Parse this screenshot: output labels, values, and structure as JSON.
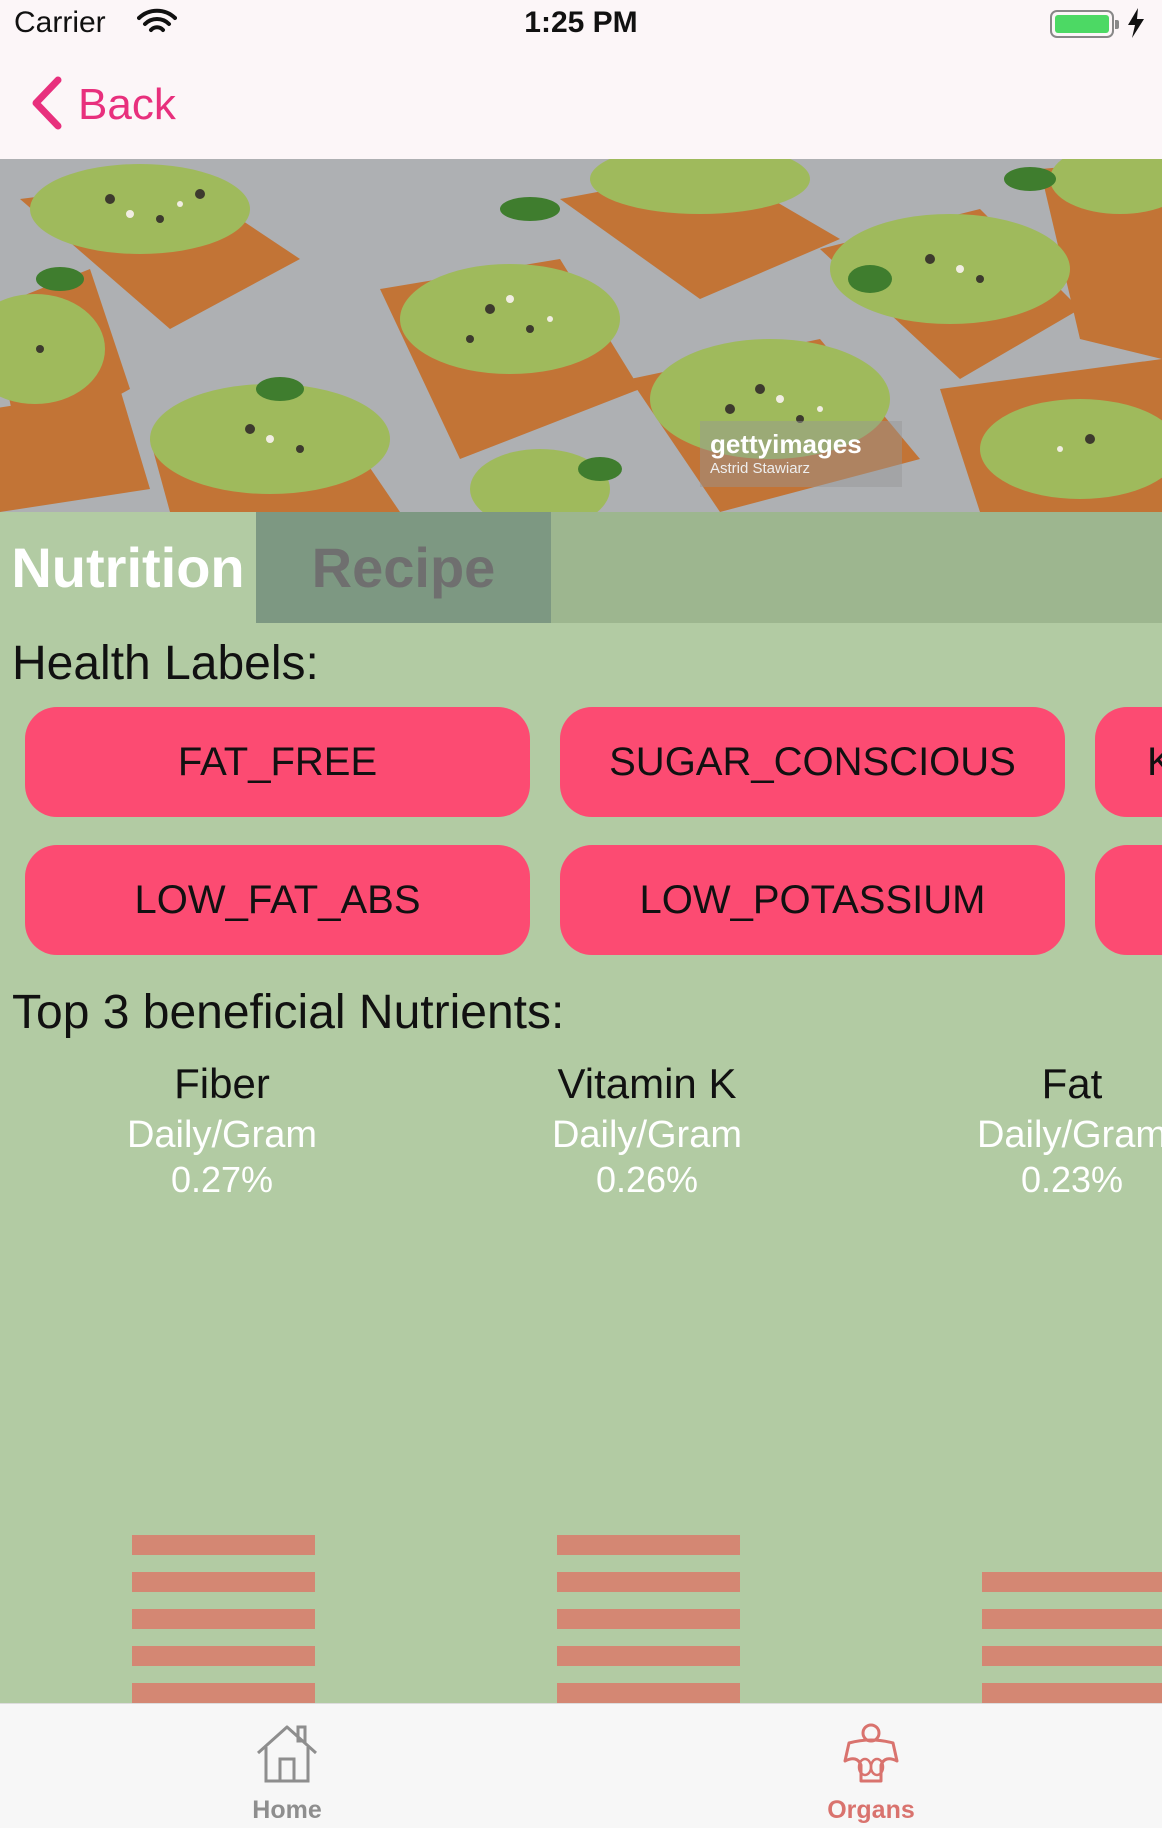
{
  "status_bar": {
    "carrier": "Carrier",
    "time": "1:25 PM"
  },
  "nav": {
    "back_label": "Back"
  },
  "hero": {
    "watermark_brand": "gettyimages",
    "watermark_credit": "Astrid Stawiarz"
  },
  "tabs": [
    {
      "label": "Nutrition",
      "selected": true
    },
    {
      "label": "Recipe",
      "selected": false
    }
  ],
  "health_labels": {
    "title": "Health Labels:",
    "row1": [
      "FAT_FREE",
      "SUGAR_CONSCIOUS",
      "K"
    ],
    "row2": [
      "LOW_FAT_ABS",
      "LOW_POTASSIUM",
      ""
    ]
  },
  "nutrients": {
    "title": "Top 3 beneficial Nutrients:",
    "items": [
      {
        "name": "Fiber",
        "unit": "Daily/Gram",
        "value": "0.27%"
      },
      {
        "name": "Vitamin K",
        "unit": "Daily/Gram",
        "value": "0.26%"
      },
      {
        "name": "Fat",
        "unit": "Daily/Gram",
        "value": "0.23%"
      }
    ]
  },
  "tab_bar": {
    "items": [
      {
        "label": "Home",
        "icon": "house-icon"
      },
      {
        "label": "Organs",
        "icon": "organs-icon",
        "selected": true
      }
    ]
  },
  "colors": {
    "accent": "#e8307d",
    "pill": "#fc4b72",
    "background": "#b2cba3",
    "bar": "#d48773"
  }
}
